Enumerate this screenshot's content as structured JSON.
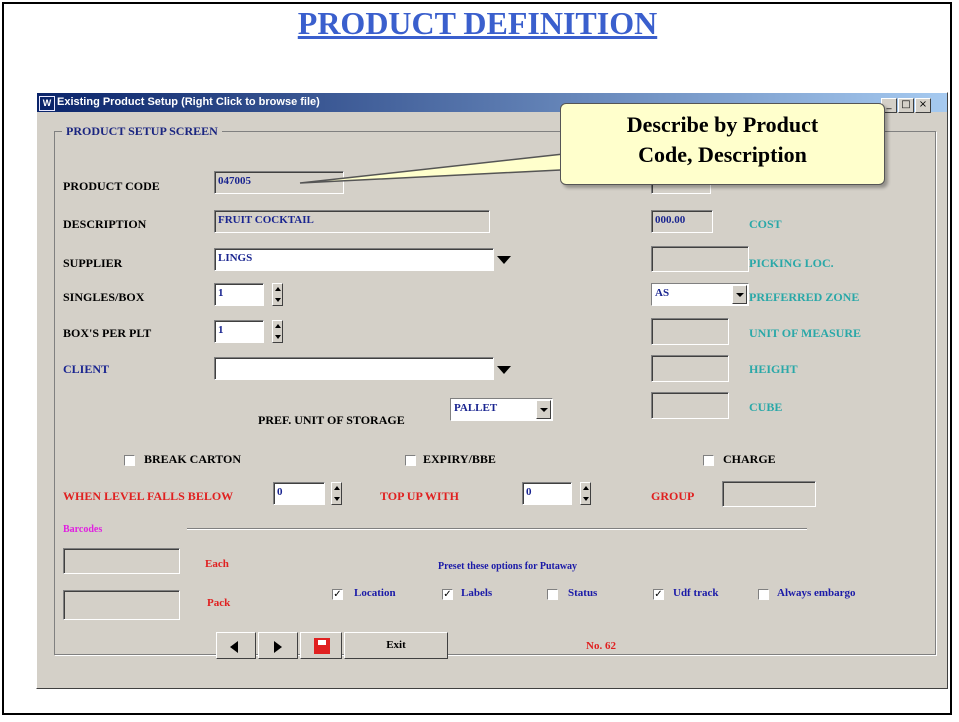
{
  "slide": {
    "title": "PRODUCT DEFINITION"
  },
  "window": {
    "title": "Existing Product Setup  (Right Click to browse file)",
    "group_label": "PRODUCT SETUP SCREEN"
  },
  "form": {
    "product_code": {
      "label": "PRODUCT CODE",
      "value": "047005"
    },
    "description": {
      "label": "DESCRIPTION",
      "value": "FRUIT COCKTAIL"
    },
    "supplier": {
      "label": "SUPPLIER",
      "value": "LINGS"
    },
    "singles_box": {
      "label": "SINGLES/BOX",
      "value": "1"
    },
    "boxs_per_plt": {
      "label": "BOX'S PER PLT",
      "value": "1"
    },
    "client": {
      "label": "CLIENT",
      "value": ""
    },
    "pref_unit_storage": {
      "label": "PREF. UNIT OF STORAGE",
      "value": "PALLET"
    },
    "cost": {
      "label": "COST",
      "value": "000.00"
    },
    "picking_loc": {
      "label": "PICKING LOC.",
      "value": ""
    },
    "preferred_zone": {
      "label": "PREFERRED ZONE",
      "value": "AS"
    },
    "unit_of_measure": {
      "label": "UNIT OF MEASURE",
      "value": ""
    },
    "height": {
      "label": "HEIGHT",
      "value": ""
    },
    "cube": {
      "label": "CUBE",
      "value": ""
    },
    "break_carton": {
      "label": "BREAK CARTON",
      "checked": false
    },
    "expiry_bbe": {
      "label": "EXPIRY/BBE",
      "checked": false
    },
    "charge": {
      "label": "CHARGE",
      "checked": false
    },
    "when_level": {
      "label": "WHEN LEVEL FALLS BELOW",
      "value": "0"
    },
    "top_up": {
      "label": "TOP UP WITH",
      "value": "0"
    },
    "group": {
      "label": "GROUP",
      "value": ""
    }
  },
  "barcodes": {
    "label": "Barcodes",
    "each_label": "Each",
    "pack_label": "Pack",
    "each_value": "",
    "pack_value": ""
  },
  "putaway": {
    "heading": "Preset these options for Putaway",
    "options": [
      {
        "label": "Location",
        "checked": true
      },
      {
        "label": "Labels",
        "checked": true
      },
      {
        "label": "Status",
        "checked": false
      },
      {
        "label": "Udf track",
        "checked": true
      },
      {
        "label": "Always embargo",
        "checked": false
      }
    ]
  },
  "nav": {
    "exit_label": "Exit",
    "record_number": "No.  62"
  },
  "callout": {
    "line1": "Describe by Product",
    "line2": "Code, Description"
  },
  "colors": {
    "window_bg": "#d4d0c8",
    "title_blue": "#3a5fcd",
    "callout_bg": "#ffffcc",
    "label_teal": "#2aa8a8",
    "label_red": "#e02020"
  }
}
